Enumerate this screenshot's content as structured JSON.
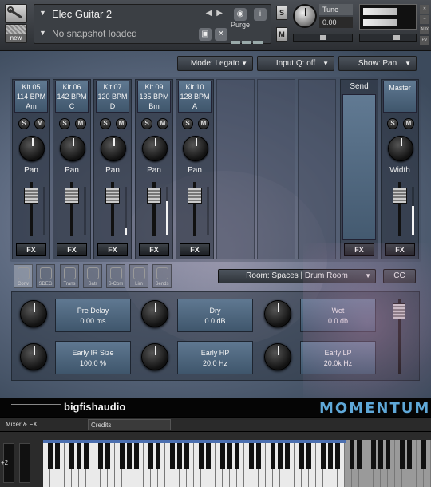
{
  "header": {
    "instrument_name": "Elec Guitar 2",
    "snapshot": "No snapshot loaded",
    "purge_label": "Purge",
    "new_label": "new",
    "solo_label": "S",
    "mute_label": "M",
    "tune_label": "Tune",
    "tune_value": "0.00",
    "aux_tag": "AUX",
    "pv_tag": "PV"
  },
  "main": {
    "mode_dropdown": "Mode: Legato",
    "input_q_dropdown": "Input Q: off",
    "show_dropdown": "Show: Pan",
    "solo_label": "S",
    "mute_label": "M",
    "fx_label": "FX",
    "channels": [
      {
        "line1": "Kit 05",
        "line2": "114 BPM",
        "line3": "Am",
        "knob_label": "Pan",
        "meter_level": 0.0
      },
      {
        "line1": "Kit 06",
        "line2": "142 BPM",
        "line3": "C",
        "knob_label": "Pan",
        "meter_level": 0.0
      },
      {
        "line1": "Kit 07",
        "line2": "120 BPM",
        "line3": "D",
        "knob_label": "Pan",
        "meter_level": 0.15
      },
      {
        "line1": "Kit 09",
        "line2": "135 BPM",
        "line3": "Bm",
        "knob_label": "Pan",
        "meter_level": 0.7
      },
      {
        "line1": "Kit 10",
        "line2": "128 BPM",
        "line3": "A",
        "knob_label": "Pan",
        "meter_level": 0.0
      }
    ],
    "send": {
      "label": "Send",
      "fx_label": "FX"
    },
    "master": {
      "label": "Master",
      "knob_label": "Width",
      "fx_label": "FX",
      "meter_level": 0.6
    },
    "effect_tabs": [
      "Conv",
      "SDEG",
      "Trans",
      "Satr",
      "S-Com",
      "Lim",
      "Sends"
    ],
    "room_dropdown": "Room: Spaces | Drum Room",
    "cc_label": "CC",
    "reverb": {
      "pre_delay": {
        "label": "Pre Delay",
        "value": "0.00 ms"
      },
      "dry": {
        "label": "Dry",
        "value": "0.0 dB"
      },
      "wet": {
        "label": "Wet",
        "value": "0.0 db"
      },
      "early_ir_size": {
        "label": "Early IR Size",
        "value": "100.0 %"
      },
      "early_hp": {
        "label": "Early HP",
        "value": "20.0 Hz"
      },
      "early_lp": {
        "label": "Early LP",
        "value": "20.0k Hz"
      }
    }
  },
  "footer": {
    "brand": "bigfishaudio",
    "product": "MOMENTUM",
    "tabs": [
      "Mixer & FX",
      "Credits"
    ]
  },
  "keyboard": {
    "octave_label": "+2"
  },
  "colors": {
    "strip_head": "#5f7891",
    "product_logo": "#5fa8d8",
    "key_range": "#4b6fb0"
  }
}
